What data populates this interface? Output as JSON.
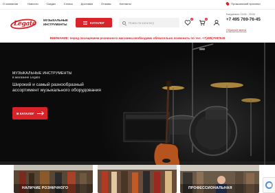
{
  "topnav": {
    "items": [
      "О компании",
      "Новости",
      "Скидки",
      "Статьи",
      "Доставка",
      "Отзывы",
      "Контакты"
    ],
    "address": "Прокшинский проспект"
  },
  "header": {
    "logo_text": "Legato",
    "tagline": "Музыкальные инструменты",
    "catalog_label": "Каталог",
    "search_placeholder": "Поиск по каталогу",
    "favorites_count": "0",
    "cart_count": "0",
    "hours": "Ежедневно: 10:00 - 20:00",
    "phone": "+7 495 769-76-45",
    "callback_label": "Обратный звонок"
  },
  "warning": {
    "text": "ВНИМАНИЕ: перед посещением розничного магазина необходимо обязательно позвонить по тел. +7(495)7697645"
  },
  "hero": {
    "kicker": "Музыкальные инструменты",
    "subtitle": "в магазине Legato",
    "description": "Широкий и самый разнообразный ассортимент музыкального оборудования",
    "button_label": "В каталог"
  },
  "cards": [
    {
      "title": "Наличие розничного"
    },
    {
      "title": ""
    },
    {
      "title": "Профессиональная"
    }
  ],
  "colors": {
    "accent": "#d8232a",
    "hero_bg": "#0b0b0b"
  },
  "icons": [
    "location-pin-icon",
    "search-icon",
    "heart-icon",
    "cart-icon",
    "user-icon",
    "burger-icon",
    "arrow-right-icon"
  ]
}
